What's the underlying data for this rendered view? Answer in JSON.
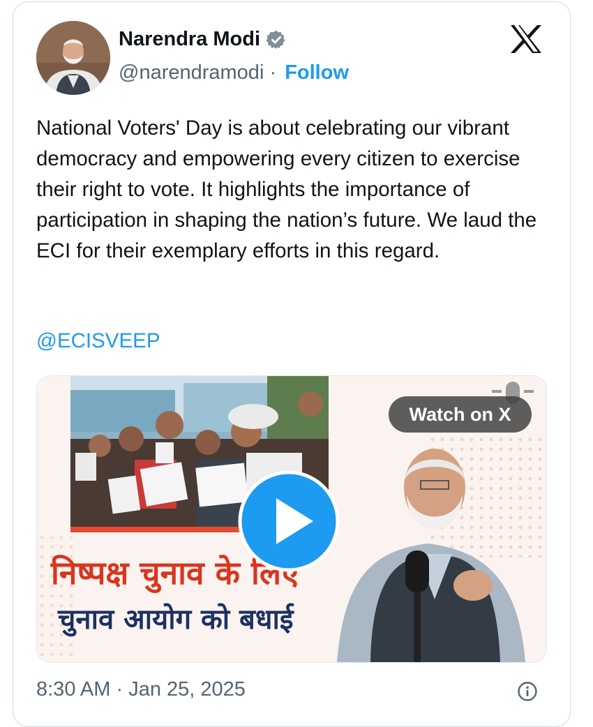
{
  "author": {
    "name": "Narendra Modi",
    "handle": "@narendramodi",
    "separator": "·",
    "follow_label": "Follow",
    "verified_icon": "verified-badge-icon"
  },
  "tweet": {
    "text": "National Voters' Day is about celebrating our vibrant democracy and empowering every citizen to exercise their right to vote. It highlights the importance of participation in shaping the nation’s future. We laud the ECI for their exemplary efforts in this regard.",
    "mention": "@ECISVEEP"
  },
  "media": {
    "watch_label": "Watch on X",
    "headline_line1": "निष्पक्ष चुनाव के लिए",
    "headline_line2": "चुनाव आयोग को बधाई",
    "play_icon": "play-icon"
  },
  "footer": {
    "time": "8:30 AM",
    "separator": "·",
    "date": "Jan 25, 2025"
  },
  "colors": {
    "accent": "#1d9bf0",
    "text": "#0f1419",
    "muted": "#536471",
    "headline_red": "#d9351f",
    "headline_navy": "#1c3163"
  }
}
